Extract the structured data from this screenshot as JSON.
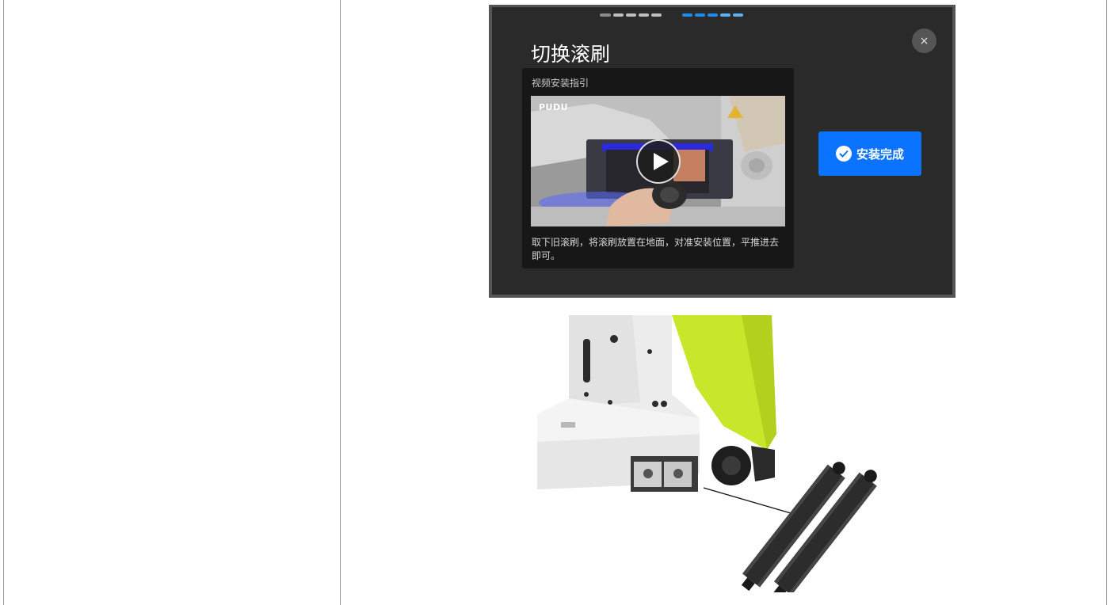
{
  "modal": {
    "title": "切换滚刷",
    "close_icon": "close-icon",
    "close_glyph": "×",
    "guide": {
      "label": "视频安装指引",
      "video_brand": "PUDU",
      "description": "取下旧滚刷，将滚刷放置在地面，对准安装位置，平推进去即可。"
    },
    "done_button": {
      "label": "安装完成",
      "icon": "check-circle-icon"
    }
  },
  "colors": {
    "accent": "#0a73ff",
    "modal_bg": "#2a2a2a",
    "card_bg": "#171717",
    "robot_green": "#c8e62a"
  }
}
